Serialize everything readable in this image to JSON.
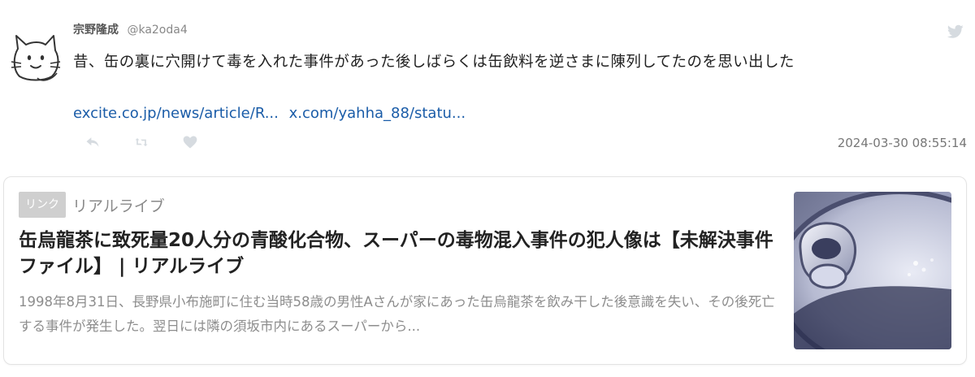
{
  "tweet": {
    "author_name": "宗野隆成",
    "author_handle": "@ka2oda4",
    "text": "昔、缶の裏に穴開けて毒を入れた事件があった後しばらくは缶飲料を逆さまに陳列してたのを思い出した",
    "links": [
      "excite.co.jp/news/article/R...",
      "x.com/yahha_88/statu..."
    ],
    "timestamp": "2024-03-30 08:55:14",
    "actions": [
      "reply-icon",
      "retweet-icon",
      "like-icon"
    ],
    "brand_icon": "twitter-bird-icon",
    "avatar_icon": "cat-doodle-icon"
  },
  "card": {
    "badge": "リンク",
    "site": "リアルライブ",
    "title": "缶烏龍茶に致死量20人分の青酸化合物、スーパーの毒物混入事件の犯人像は【未解決事件ファイル】 | リアルライブ",
    "description": "1998年8月31日、長野県小布施町に住む当時58歳の男性Aさんが家にあった缶烏龍茶を飲み干した後意識を失い、その後死亡する事件が発生した。翌日には隣の須坂市内にあるスーパーから...",
    "thumbnail_icon": "can-pull-tab-image"
  },
  "colors": {
    "link": "#1a5ca8",
    "muted": "#8d8d8d",
    "icon": "#d6dbe0",
    "badge_bg": "#cfcfcf"
  }
}
